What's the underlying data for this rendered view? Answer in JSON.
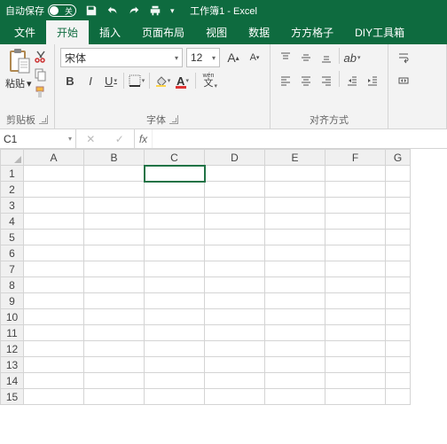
{
  "titlebar": {
    "autosave_label": "自动保存",
    "toggle_label": "关",
    "doc_title": "工作簿1 - Excel"
  },
  "tabs": [
    "文件",
    "开始",
    "插入",
    "页面布局",
    "视图",
    "数据",
    "方方格子",
    "DIY工具箱"
  ],
  "active_tab_index": 1,
  "ribbon": {
    "clipboard": {
      "paste_label": "粘贴",
      "group_label": "剪贴板"
    },
    "font": {
      "font_name": "宋体",
      "font_size": "12",
      "group_label": "字体",
      "bold": "B",
      "italic": "I",
      "underline": "U",
      "phonetic": "wén",
      "phonetic_cn": "文"
    },
    "align": {
      "group_label": "对齐方式"
    }
  },
  "namebox": "C1",
  "fx_label": "fx",
  "columns": [
    "A",
    "B",
    "C",
    "D",
    "E",
    "F",
    "G"
  ],
  "rows": [
    1,
    2,
    3,
    4,
    5,
    6,
    7,
    8,
    9,
    10,
    11,
    12,
    13,
    14,
    15
  ],
  "active_cell": {
    "row": 1,
    "col": 2
  }
}
